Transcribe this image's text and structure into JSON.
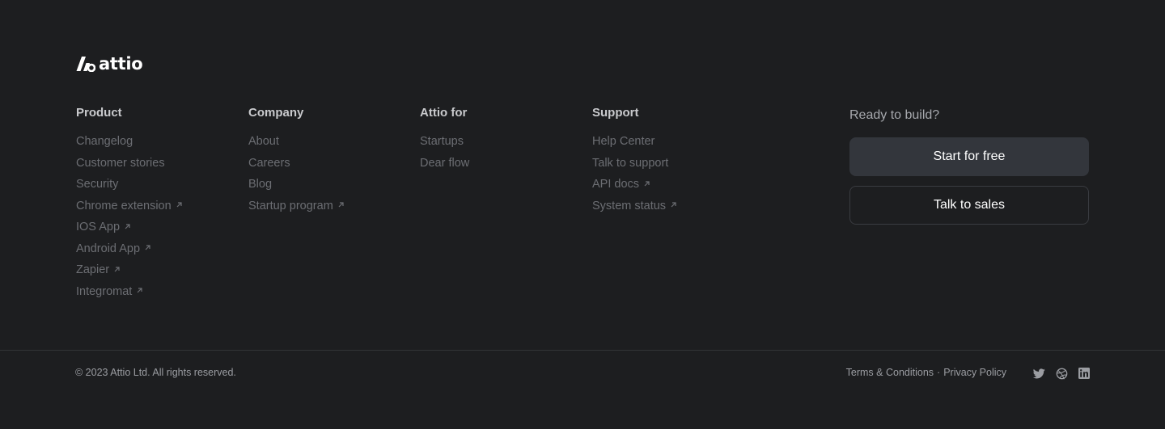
{
  "brand": {
    "name": "attio",
    "logo_icon": "attio-logo-icon"
  },
  "columns": [
    {
      "heading": "Product",
      "links": [
        {
          "label": "Changelog",
          "external": false
        },
        {
          "label": "Customer stories",
          "external": false
        },
        {
          "label": "Security",
          "external": false
        },
        {
          "label": "Chrome extension",
          "external": true
        },
        {
          "label": "IOS App",
          "external": true
        },
        {
          "label": "Android App",
          "external": true
        },
        {
          "label": "Zapier",
          "external": true
        },
        {
          "label": "Integromat",
          "external": true
        }
      ]
    },
    {
      "heading": "Company",
      "links": [
        {
          "label": "About",
          "external": false
        },
        {
          "label": "Careers",
          "external": false
        },
        {
          "label": "Blog",
          "external": false
        },
        {
          "label": "Startup program",
          "external": true
        }
      ]
    },
    {
      "heading": "Attio for",
      "links": [
        {
          "label": "Startups",
          "external": false
        },
        {
          "label": "Dear flow",
          "external": false
        }
      ]
    },
    {
      "heading": "Support",
      "links": [
        {
          "label": "Help Center",
          "external": false
        },
        {
          "label": "Talk to support",
          "external": false
        },
        {
          "label": "API docs",
          "external": true
        },
        {
          "label": "System status",
          "external": true
        }
      ]
    }
  ],
  "cta": {
    "title": "Ready to build?",
    "primary_label": "Start for free",
    "secondary_label": "Talk to sales"
  },
  "footer": {
    "copyright": "© 2023 Attio Ltd. All rights reserved.",
    "terms_label": "Terms & Conditions",
    "separator": "·",
    "privacy_label": "Privacy Policy",
    "social_icons": [
      "twitter-icon",
      "dribbble-icon",
      "linkedin-icon"
    ]
  },
  "colors": {
    "background": "#1d1e20",
    "heading_text": "#c9cacd",
    "link_text": "#6c6e73",
    "primary_button": "#33363c",
    "button_text": "#ffffff"
  }
}
